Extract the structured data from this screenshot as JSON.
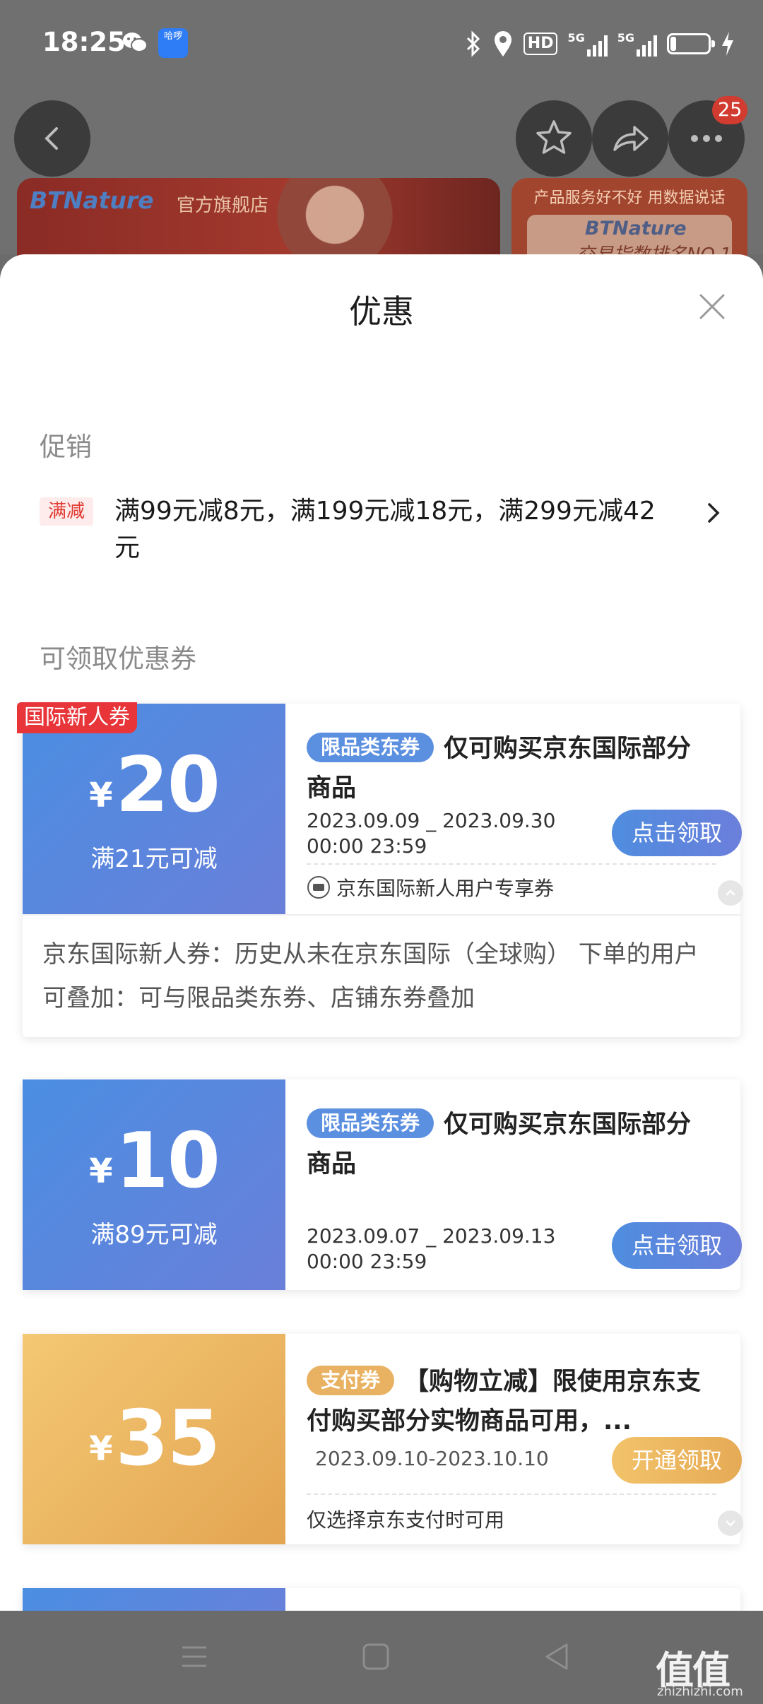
{
  "status_bar": {
    "time": "18:25",
    "app_badge_text": "哈啰",
    "hd_label": "HD",
    "network_1": "5G",
    "network_2": "5G",
    "battery_level": 0.15
  },
  "header": {
    "more_badge": "25"
  },
  "banners": {
    "left_brand": "BTNature",
    "left_store": "官方旗舰店",
    "right_slogan": "产品服务好不好 用数据说话",
    "right_brand": "BTNature",
    "right_rank": "交易指数排名NO.1"
  },
  "sheet": {
    "title": "优惠",
    "promotion_section_label": "促销",
    "promotion_tag": "满减",
    "promotion_text": "满99元减8元，满199元减18元，满299元减42元",
    "coupons_section_label": "可领取优惠券"
  },
  "coupons": [
    {
      "corner_tag": "国际新人券",
      "currency": "¥",
      "amount": "20",
      "condition": "满21元可减",
      "type": "限品类东券",
      "description": "仅可购买京东国际部分商品",
      "date_line1": "2023.09.09 _ 2023.09.30",
      "date_line2": "00:00 23:59",
      "button": "点击领取",
      "footer_note": "京东国际新人用户专享券",
      "detail_line1": "京东国际新人券：历史从未在京东国际（全球购） 下单的用户",
      "detail_line2": "可叠加：可与限品类东券、店铺东券叠加"
    },
    {
      "currency": "¥",
      "amount": "10",
      "condition": "满89元可减",
      "type": "限品类东券",
      "description": "仅可购买京东国际部分商品",
      "date_line1": "2023.09.07 _ 2023.09.13",
      "date_line2": "00:00 23:59",
      "button": "点击领取"
    },
    {
      "currency": "¥",
      "amount": "35",
      "type": "支付券",
      "description": "【购物立减】限使用京东支付购买部分实物商品可用，...",
      "date_range": "2023.09.10-2023.10.10",
      "button": "开通领取",
      "footer_note": "仅选择京东支付时可用"
    }
  ],
  "watermark": {
    "text": "值值值",
    "url": "zhizhizhi.com"
  },
  "colors": {
    "accent_blue": "#5b8fe0",
    "accent_gold": "#e9b262",
    "promo_red": "#e03a32"
  }
}
